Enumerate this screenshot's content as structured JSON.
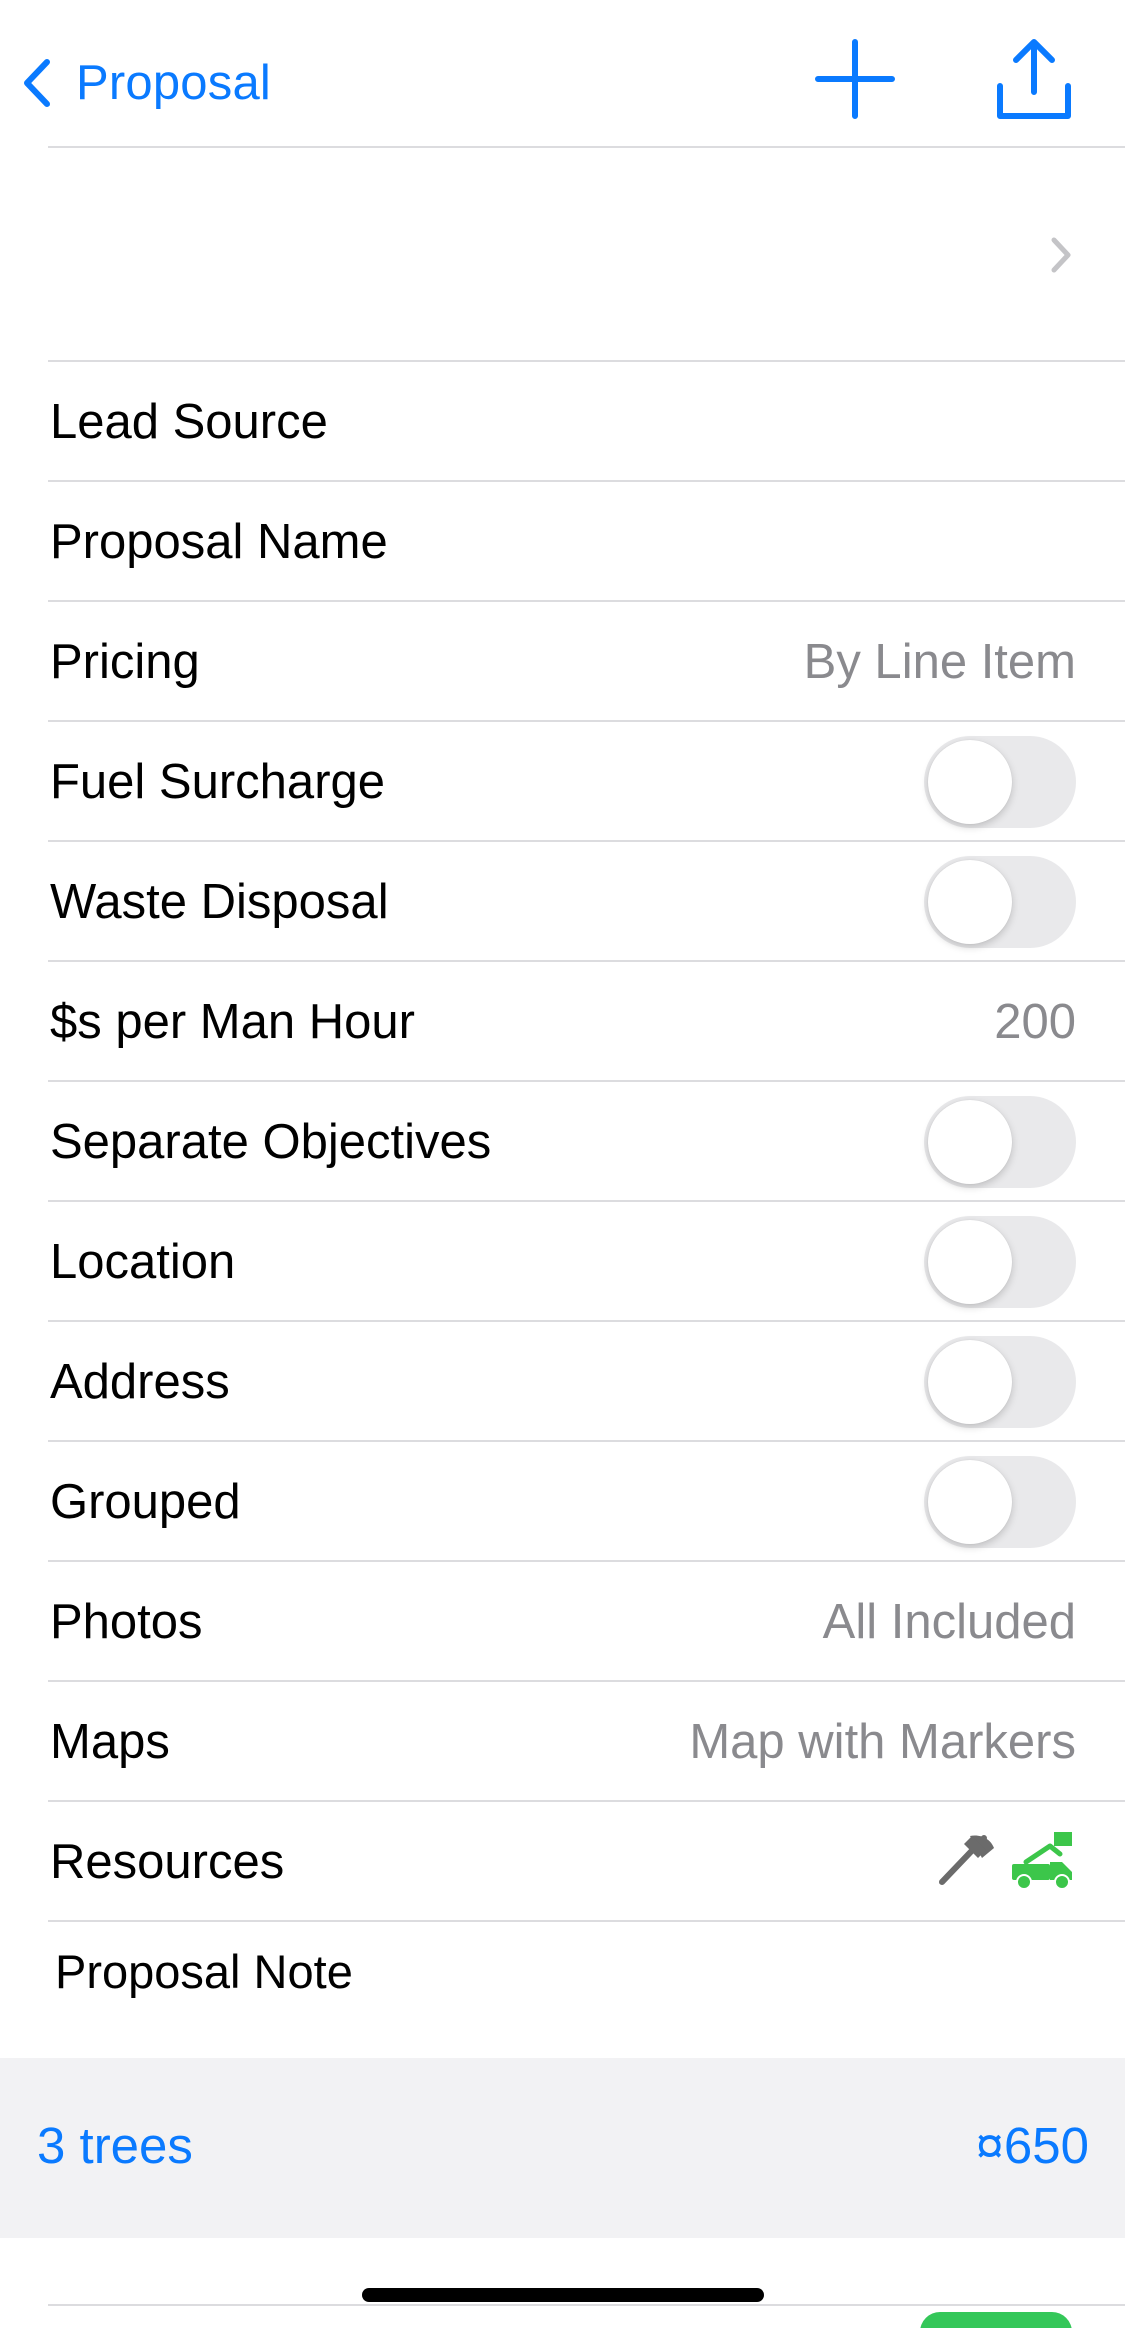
{
  "nav": {
    "back_label": "Proposal",
    "back_icon": "chevron-left-icon",
    "add_icon": "plus-icon",
    "share_icon": "share-icon",
    "accent_color": "#0A7AFF"
  },
  "client": {
    "name": "",
    "chevron_icon": "chevron-right-icon"
  },
  "rows": {
    "lead_source": {
      "label": "Lead Source",
      "value": ""
    },
    "proposal_name": {
      "label": "Proposal Name",
      "value": ""
    },
    "pricing": {
      "label": "Pricing",
      "value": "By Line Item"
    },
    "fuel_surcharge": {
      "label": "Fuel Surcharge",
      "on": false
    },
    "waste_disposal": {
      "label": "Waste Disposal",
      "on": false
    },
    "per_man_hour": {
      "label": "$s per Man Hour",
      "value": "200"
    },
    "separate_objectives": {
      "label": "Separate Objectives",
      "on": false
    },
    "location": {
      "label": "Location",
      "on": false
    },
    "address": {
      "label": "Address",
      "on": false
    },
    "grouped": {
      "label": "Grouped",
      "on": false
    },
    "photos": {
      "label": "Photos",
      "value": "All Included"
    },
    "maps": {
      "label": "Maps",
      "value": "Map with Markers"
    },
    "resources": {
      "label": "Resources",
      "icons": [
        "axe-icon",
        "bucket-truck-icon"
      ],
      "axe_color": "#6b6b6b",
      "truck_color": "#3CC64A"
    }
  },
  "note": {
    "label": "Proposal Note"
  },
  "summary": {
    "count": "3 trees",
    "total": "¤650"
  }
}
